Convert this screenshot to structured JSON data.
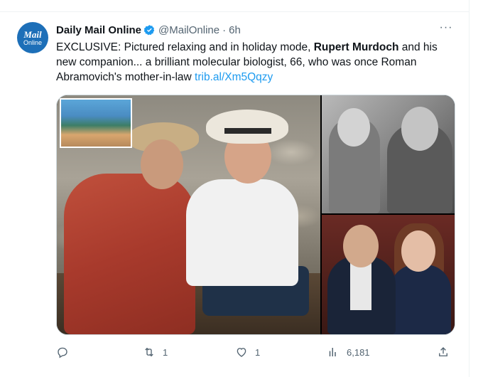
{
  "tweet": {
    "avatar_line1": "Mail",
    "avatar_line2": "Online",
    "author_name": "Daily Mail Online",
    "handle": "@MailOnline",
    "separator": "·",
    "time": "6h",
    "more_label": "···",
    "text_before_bold": "EXCLUSIVE: Pictured relaxing and in holiday mode, ",
    "text_bold": "Rupert Murdoch",
    "text_after_bold": " and his new companion... a brilliant molecular biologist, 66, who was once Roman Abramovich's mother-in-law ",
    "link_text": "trib.al/Xm5Qqzy"
  },
  "actions": {
    "reply_count": "",
    "retweet_count": "1",
    "like_count": "1",
    "views_count": "6,181"
  },
  "icons": {
    "verified": "verified-badge-icon",
    "reply": "reply-icon",
    "retweet": "retweet-icon",
    "like": "heart-icon",
    "views": "views-chart-icon",
    "share": "share-icon"
  },
  "colors": {
    "accent": "#1d9bf0",
    "muted_text": "#536471",
    "avatar_bg": "#1d6fb8"
  }
}
